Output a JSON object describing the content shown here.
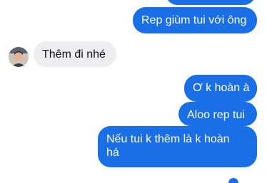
{
  "messages": [
    {
      "side": "out",
      "text": ""
    },
    {
      "side": "out",
      "text": "Rep giùm tui với ông"
    },
    {
      "side": "in",
      "text": "Thêm đi nhé"
    },
    {
      "side": "out",
      "text": "Ơ k hoàn à"
    },
    {
      "side": "out",
      "text": "Aloo rep tui"
    },
    {
      "side": "out",
      "text_line1": "Nếu tui k thêm là k hoàn",
      "text_line2": "há"
    }
  ],
  "colors": {
    "outgoing_bubble": "#1b6fe6",
    "incoming_bubble": "#eeeef0"
  },
  "icons": {
    "avatar": "contact-avatar",
    "seen_indicator": "seen-indicator-icon"
  }
}
